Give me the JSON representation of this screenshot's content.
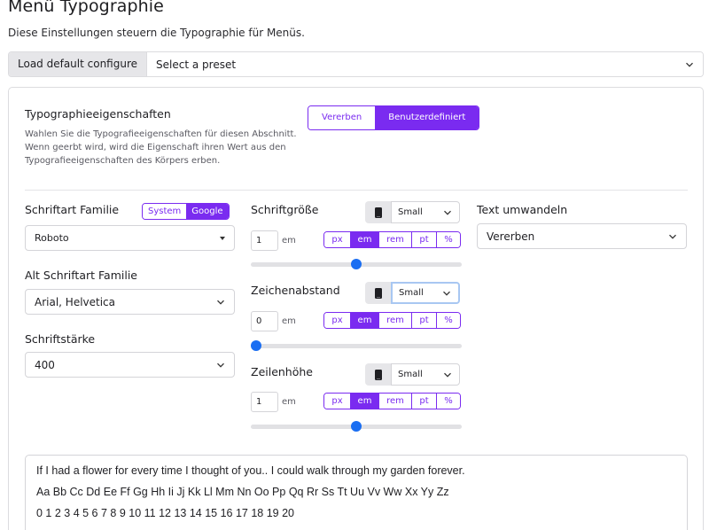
{
  "header": {
    "title": "Menü Typographie",
    "subtitle": "Diese Einstellungen steuern die Typographie für Menüs."
  },
  "preset": {
    "button_label": "Load default configure",
    "select_value": "Select a preset"
  },
  "typography_properties": {
    "title": "Typographieeigenschaften",
    "help": "Wahlen Sie die Typografieeigenschaften für diesen Abschnitt. Wenn geerbt wird, wird die Eigenschaft ihren Wert aus den Typografieeigenschaften des Körpers erben.",
    "options": [
      "Vererben",
      "Benutzerdefiniert"
    ],
    "active": "Benutzerdefiniert"
  },
  "font_family": {
    "label": "Schriftart Familie",
    "source_options": [
      "System",
      "Google"
    ],
    "active_source": "Google",
    "value": "Roboto"
  },
  "alt_font_family": {
    "label": "Alt Schriftart Familie",
    "value": "Arial, Helvetica"
  },
  "font_weight": {
    "label": "Schriftstärke",
    "value": "400"
  },
  "font_size": {
    "label": "Schriftgröße",
    "device_value": "Small",
    "value": "1",
    "unit": "em",
    "units": [
      "px",
      "em",
      "rem",
      "pt",
      "%"
    ],
    "slider_fraction": 0.5
  },
  "letter_spacing": {
    "label": "Zeichenabstand",
    "device_value": "Small",
    "value": "0",
    "unit": "em",
    "units": [
      "px",
      "em",
      "rem",
      "pt",
      "%"
    ],
    "slider_fraction": 0.0
  },
  "line_height": {
    "label": "Zeilenhöhe",
    "device_value": "Small",
    "value": "1",
    "unit": "em",
    "units": [
      "px",
      "em",
      "rem",
      "pt",
      "%"
    ],
    "slider_fraction": 0.5
  },
  "text_transform": {
    "label": "Text umwandeln",
    "value": "Vererben"
  },
  "preview": {
    "line1": "If I had a flower for every time I thought of you.. I could walk through my garden forever.",
    "line2": "Aa Bb Cc Dd Ee Ff Gg Hh Ii Jj Kk Ll Mm Nn Oo Pp Qq Rr Ss Tt Uu Vv Ww Xx Yy Zz",
    "line3": "0 1 2 3 4 5 6 7 8 9 10 11 12 13 14 15 16 17 18 19 20"
  },
  "colors": {
    "accent": "#7a2bf0",
    "slider_thumb": "#1a6ef2"
  }
}
